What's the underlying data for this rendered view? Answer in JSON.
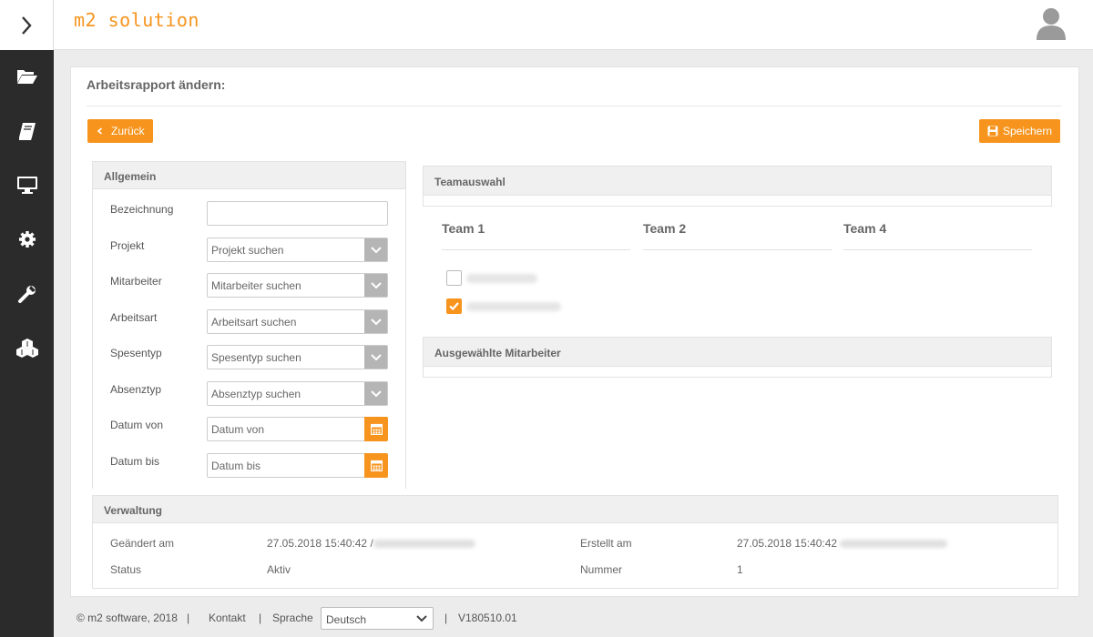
{
  "header": {
    "logo": "m2 solution"
  },
  "sidebar": {
    "toggle_icon": "chevron-right-icon",
    "items": [
      {
        "icon": "folder-open-icon"
      },
      {
        "icon": "book-icon"
      },
      {
        "icon": "monitor-icon"
      },
      {
        "icon": "gear-icon"
      },
      {
        "icon": "wrench-icon"
      },
      {
        "icon": "cubes-icon"
      }
    ]
  },
  "page": {
    "title": "Arbeitsrapport ändern:",
    "back_label": "Zurück",
    "save_label": "Speichern"
  },
  "allgemein": {
    "title": "Allgemein",
    "fields": {
      "bezeichnung": {
        "label": "Bezeichnung",
        "value": ""
      },
      "projekt": {
        "label": "Projekt",
        "placeholder": "Projekt suchen"
      },
      "mitarbeiter": {
        "label": "Mitarbeiter",
        "placeholder": "Mitarbeiter suchen"
      },
      "arbeitsart": {
        "label": "Arbeitsart",
        "placeholder": "Arbeitsart suchen"
      },
      "spesentyp": {
        "label": "Spesentyp",
        "placeholder": "Spesentyp suchen"
      },
      "absenztyp": {
        "label": "Absenztyp",
        "placeholder": "Absenztyp suchen"
      },
      "datum_von": {
        "label": "Datum von",
        "placeholder": "Datum von"
      },
      "datum_bis": {
        "label": "Datum bis",
        "placeholder": "Datum bis"
      }
    }
  },
  "teamauswahl": {
    "title": "Teamauswahl",
    "teams": [
      "Team 1",
      "Team 2",
      "Team 4"
    ],
    "members": [
      {
        "checked": false
      },
      {
        "checked": true
      }
    ]
  },
  "ausgewaehlt": {
    "title": "Ausgewählte Mitarbeiter"
  },
  "verwaltung": {
    "title": "Verwaltung",
    "geaendert_label": "Geändert am",
    "geaendert_value": "27.05.2018 15:40:42 /",
    "erstellt_label": "Erstellt am",
    "erstellt_value": "27.05.2018 15:40:42",
    "status_label": "Status",
    "status_value": "Aktiv",
    "nummer_label": "Nummer",
    "nummer_value": "1"
  },
  "footer": {
    "copyright": "© m2 software, 2018",
    "sep": "|",
    "kontakt": "Kontakt",
    "sprache_label": "Sprache",
    "sprache_value": "Deutsch",
    "version": "V180510.01"
  },
  "colors": {
    "accent": "#f7941d",
    "sidebar": "#2b2b2b"
  }
}
